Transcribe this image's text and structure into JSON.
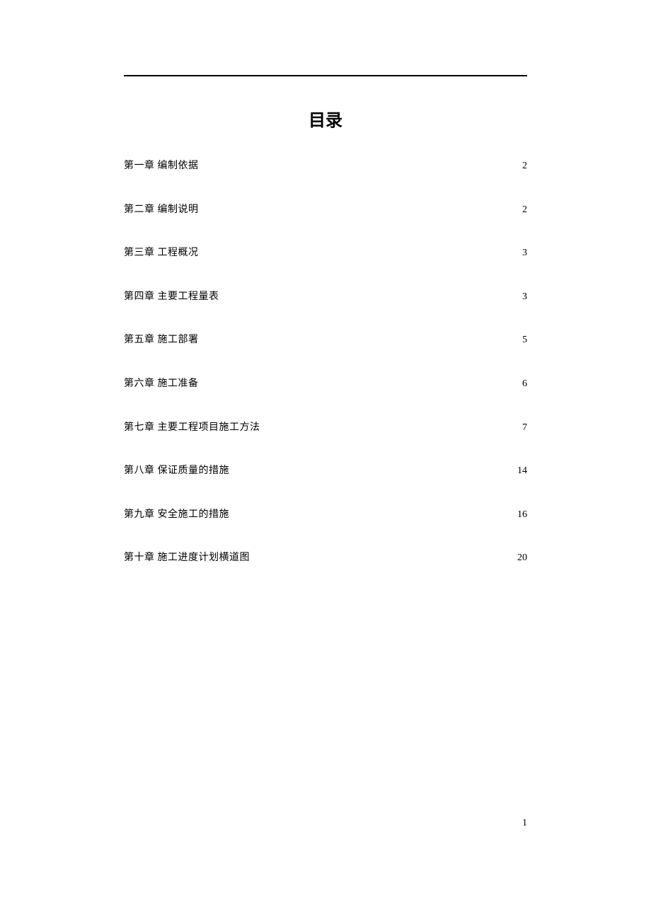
{
  "title": "目录",
  "page_number": "1",
  "toc": [
    {
      "label": "第一章 编制依据",
      "page": "2"
    },
    {
      "label": "第二章 编制说明",
      "page": "2"
    },
    {
      "label": "第三章 工程概况",
      "page": "3"
    },
    {
      "label": "第四章 主要工程量表",
      "page": "3"
    },
    {
      "label": "第五章 施工部署",
      "page": "5"
    },
    {
      "label": "第六章 施工准备",
      "page": "6"
    },
    {
      "label": "第七章 主要工程项目施工方法",
      "page": "7"
    },
    {
      "label": "第八章 保证质量的措施",
      "page": "14"
    },
    {
      "label": "第九章  安全施工的措施",
      "page": "16"
    },
    {
      "label": "第十章 施工进度计划横道图",
      "page": "20"
    }
  ]
}
